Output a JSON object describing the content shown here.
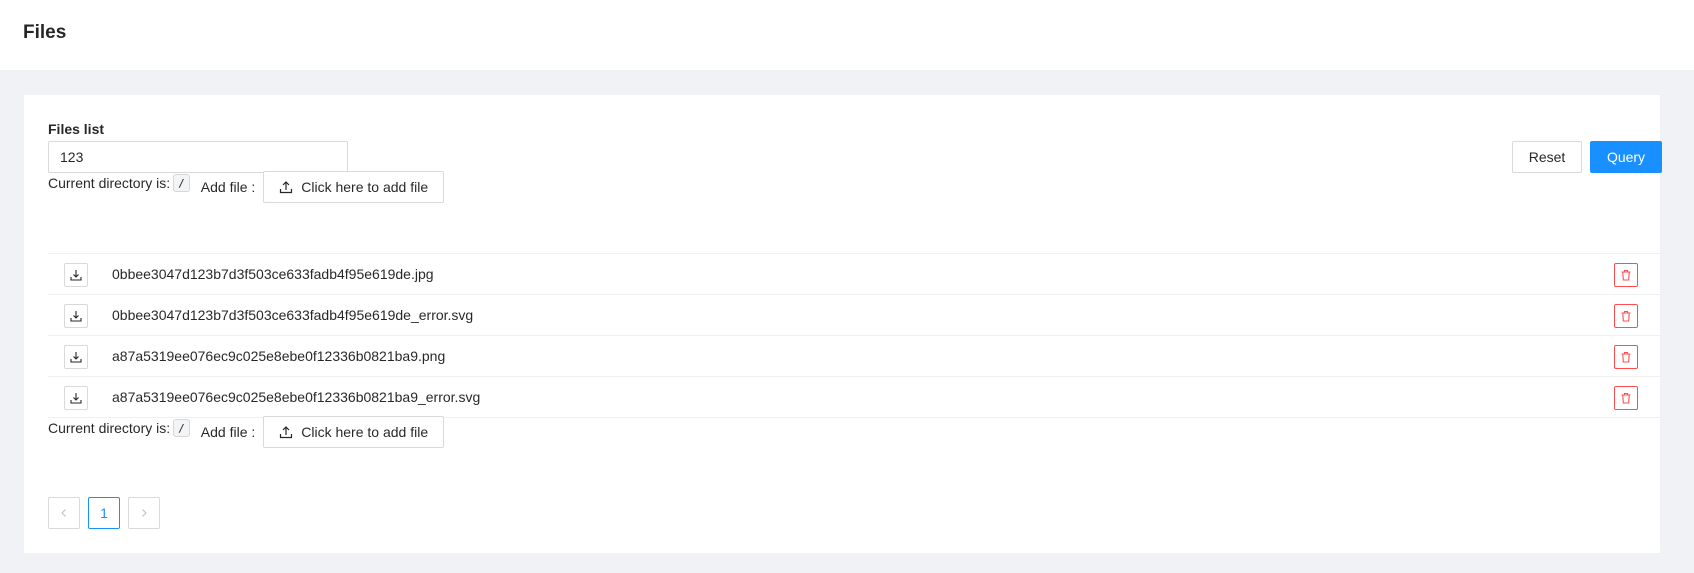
{
  "header": {
    "title": "Files"
  },
  "form": {
    "label": "Files list",
    "search_value": "123",
    "reset_label": "Reset",
    "query_label": "Query"
  },
  "directory": {
    "prefix": "Current directory is:",
    "path": "/",
    "add_file_label": "Add file :",
    "upload_label": "Click here to add file"
  },
  "files": [
    {
      "name": "0bbee3047d123b7d3f503ce633fadb4f95e619de.jpg"
    },
    {
      "name": "0bbee3047d123b7d3f503ce633fadb4f95e619de_error.svg"
    },
    {
      "name": "a87a5319ee076ec9c025e8ebe0f12336b0821ba9.png"
    },
    {
      "name": "a87a5319ee076ec9c025e8ebe0f12336b0821ba9_error.svg"
    }
  ],
  "pagination": {
    "prev_icon": "left-chevron-icon",
    "current_page": "1",
    "next_icon": "right-chevron-icon"
  },
  "colors": {
    "primary": "#1890ff",
    "danger": "#ff4d4f",
    "background": "#f0f2f5"
  }
}
